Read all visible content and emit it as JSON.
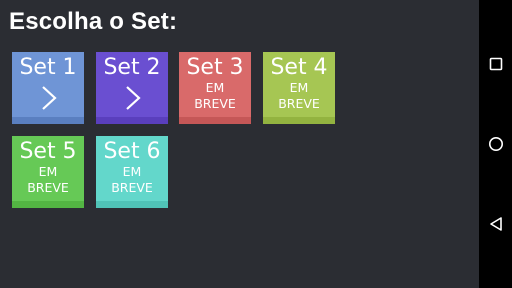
{
  "screen": {
    "title": "Escolha o Set:"
  },
  "sets": [
    {
      "label": "Set 1",
      "status": "available",
      "color": "#6f95d6",
      "bar_color": "#5a7fc0"
    },
    {
      "label": "Set 2",
      "status": "available",
      "color": "#6a4fd1",
      "bar_color": "#5a3fbd"
    },
    {
      "label": "Set 3",
      "status": "soon",
      "line1": "EM",
      "line2": "BREVE",
      "color": "#d96a6a",
      "bar_color": "#c55757"
    },
    {
      "label": "Set 4",
      "status": "soon",
      "line1": "EM",
      "line2": "BREVE",
      "color": "#a6c653",
      "bar_color": "#93b340"
    },
    {
      "label": "Set 5",
      "status": "soon",
      "line1": "EM",
      "line2": "BREVE",
      "color": "#66c956",
      "bar_color": "#53b543"
    },
    {
      "label": "Set 6",
      "status": "soon",
      "line1": "EM",
      "line2": "BREVE",
      "color": "#63d7cb",
      "bar_color": "#50c3b7"
    }
  ],
  "navigation_bar": {
    "background": "#000000",
    "buttons": [
      {
        "icon": "recents-square-icon"
      },
      {
        "icon": "home-circle-icon"
      },
      {
        "icon": "back-triangle-icon"
      }
    ]
  }
}
